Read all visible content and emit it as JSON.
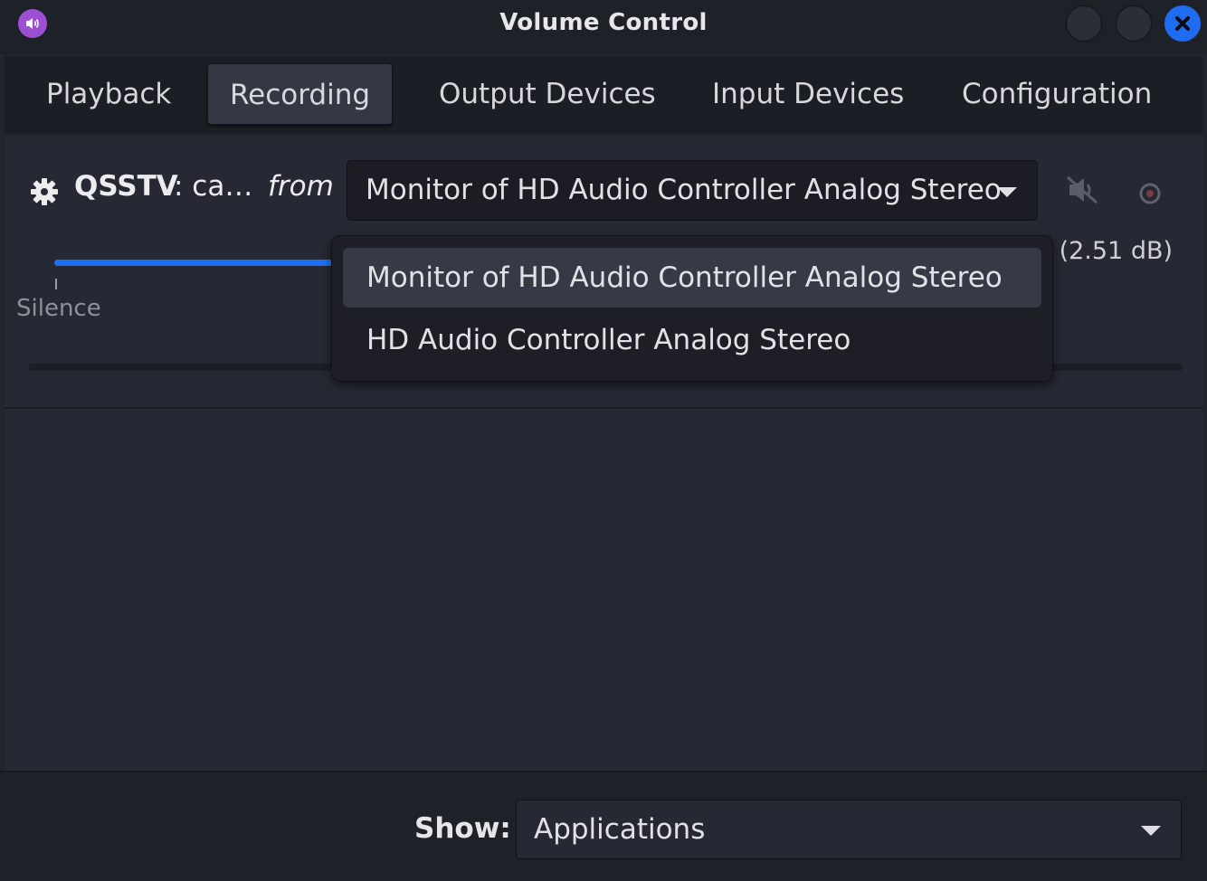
{
  "window": {
    "title": "Volume Control",
    "app_icon": "speaker-icon",
    "controls": [
      "minimize-icon",
      "maximize-icon",
      "close-icon"
    ],
    "accent_color": "#1f6cf0"
  },
  "tabs": [
    {
      "label": "Playback",
      "active": false
    },
    {
      "label": "Recording",
      "active": true
    },
    {
      "label": "Output Devices",
      "active": false
    },
    {
      "label": "Input Devices",
      "active": false
    },
    {
      "label": "Configuration",
      "active": false
    }
  ],
  "stream": {
    "icon": "gear-icon",
    "app_name": "QSSTV",
    "description": ": ca…",
    "from_label": "from",
    "source_selected": "Monitor of HD Audio Controller Analog Stereo",
    "mute_icon": "speaker-muted-icon",
    "lock_icon": "record-lock-icon",
    "volume_db": "̵ (2.51 dB)",
    "silence_label": "Silence"
  },
  "source_dropdown": {
    "open": true,
    "options": [
      {
        "label": "Monitor of HD Audio Controller Analog Stereo",
        "selected": true
      },
      {
        "label": "HD Audio Controller Analog Stereo",
        "selected": false
      }
    ]
  },
  "footer": {
    "show_label": "Show:",
    "show_value": "Applications"
  }
}
